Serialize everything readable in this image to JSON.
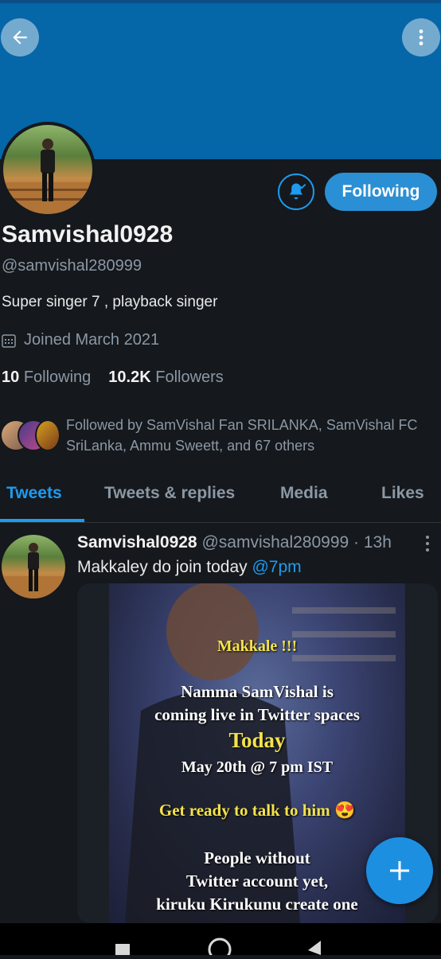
{
  "header": {
    "back_icon": "arrow-left-icon",
    "more_icon": "vertical-dots-icon",
    "banner_color": "#0566a8"
  },
  "profile": {
    "display_name": "Samvishal0928",
    "handle": "@samvishal280999",
    "bio": "Super singer 7 , playback singer",
    "joined": "Joined March 2021",
    "following_count": "10",
    "following_label": "Following",
    "followers_count": "10.2K",
    "followers_label": "Followers",
    "followed_by": "Followed by SamVishal Fan SRILANKA, SamVishal FC SriLanka, Ammu Sweett, and 67 others",
    "follow_button_label": "Following",
    "accent_color": "#1d9bf0"
  },
  "tabs": [
    {
      "label": "Tweets",
      "active": true
    },
    {
      "label": "Tweets & replies",
      "active": false
    },
    {
      "label": "Media",
      "active": false
    },
    {
      "label": "Likes",
      "active": false
    }
  ],
  "tweet": {
    "name": "Samvishal0928",
    "handle_time": "@samvishal280999 · 13h",
    "text": "Makkaley do join today ",
    "link_text": "@7pm",
    "poster_lines": [
      "Makkale !!!",
      "Namma SamVishal is",
      "coming live in Twitter spaces",
      "Today",
      "May 20th @ 7 pm IST",
      "Get ready to talk to him 😍",
      "People without",
      "Twitter account yet,",
      "kiruku Kirukunu create one"
    ]
  },
  "fab": {
    "icon": "plus-icon"
  },
  "system_nav": {
    "icons": [
      "recents-square-icon",
      "home-circle-icon",
      "back-triangle-icon"
    ]
  }
}
